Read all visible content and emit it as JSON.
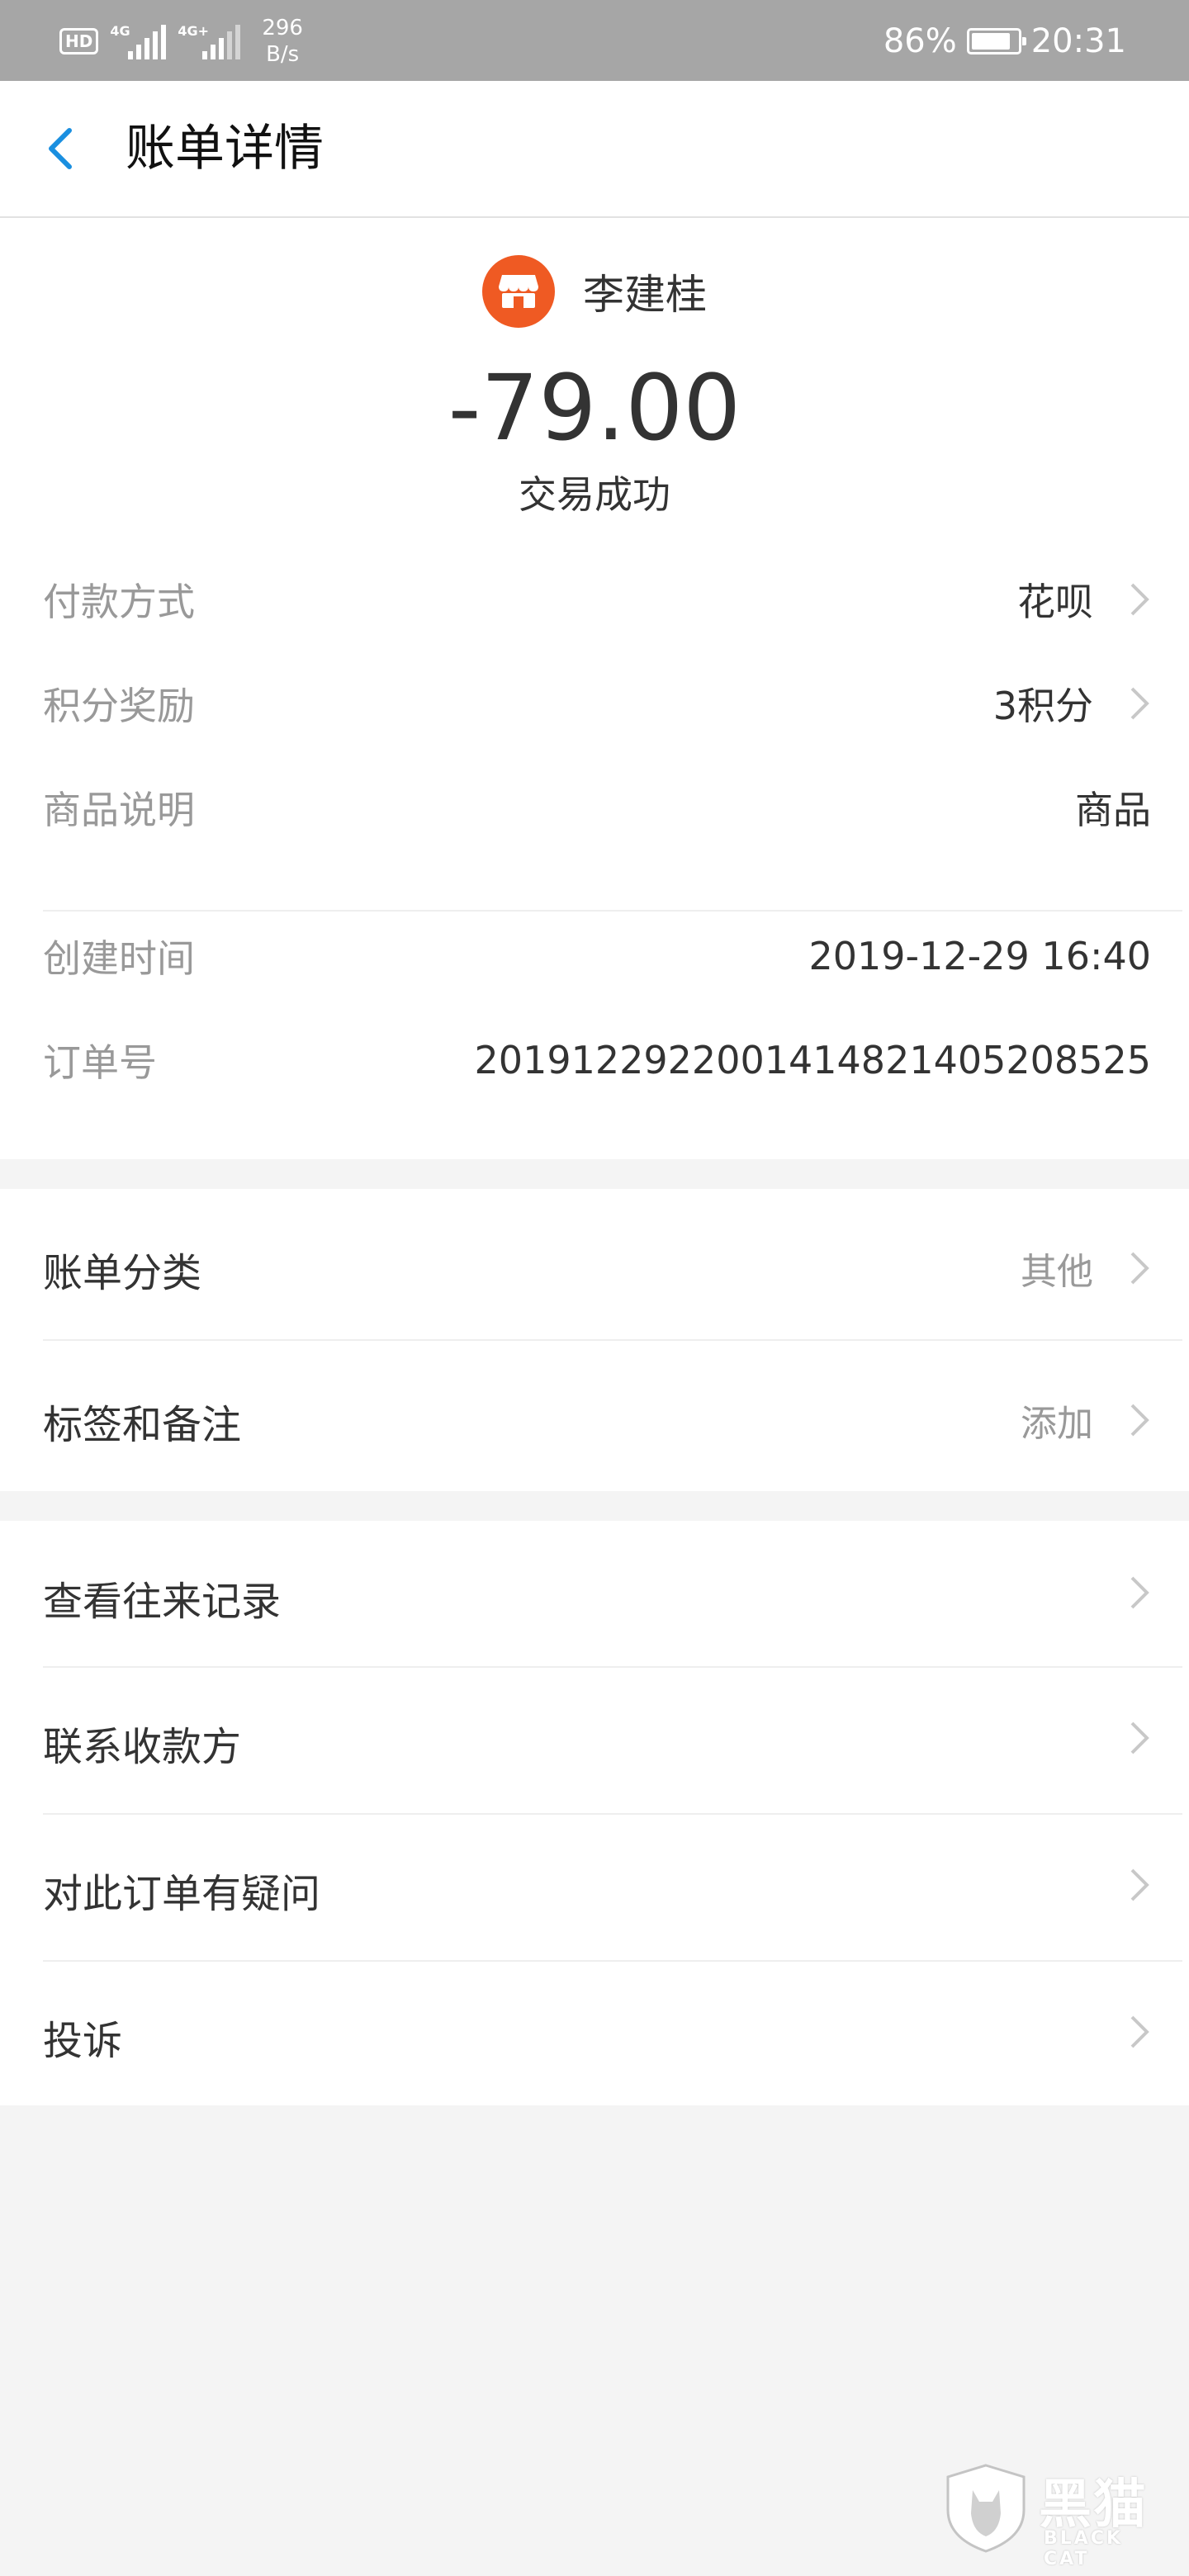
{
  "status_bar": {
    "hd_badge": "HD",
    "sim1_label": "4G",
    "sim2_label": "4G+",
    "net_speed_value": "296",
    "net_speed_unit": "B/s",
    "battery_percent": 86,
    "battery_text": "86%",
    "time": "20:31"
  },
  "nav": {
    "title": "账单详情",
    "back_icon": "chevron-left-icon"
  },
  "merchant": {
    "name": "李建桂",
    "icon": "store-icon",
    "icon_color": "#ef5a23"
  },
  "transaction": {
    "amount": "-79.00",
    "status": "交易成功"
  },
  "details": [
    {
      "label": "付款方式",
      "value": "花呗",
      "has_arrow": true
    },
    {
      "label": "积分奖励",
      "value": "3积分",
      "has_arrow": true
    },
    {
      "label": "商品说明",
      "value": "商品",
      "has_arrow": false
    },
    {
      "label": "创建时间",
      "value": "2019-12-29 16:40",
      "has_arrow": false
    },
    {
      "label": "订单号",
      "value": "2019122922001414821405208525",
      "has_arrow": false
    }
  ],
  "category_section": [
    {
      "label": "账单分类",
      "value": "其他"
    },
    {
      "label": "标签和备注",
      "value": "添加"
    }
  ],
  "action_section": [
    {
      "label": "查看往来记录"
    },
    {
      "label": "联系收款方"
    },
    {
      "label": "对此订单有疑问"
    },
    {
      "label": "投诉"
    }
  ],
  "watermark": {
    "logo_text": "黑猫",
    "logo_sub": "BLACK CAT"
  }
}
